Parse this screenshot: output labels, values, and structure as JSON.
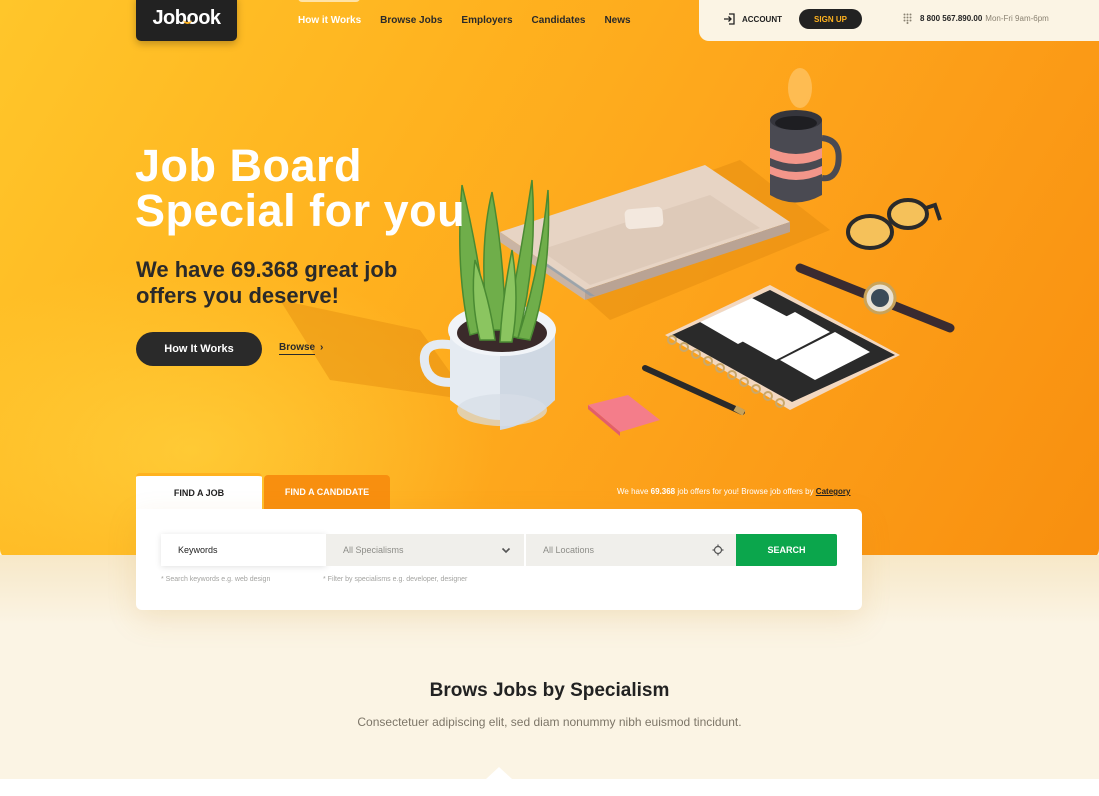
{
  "brand": {
    "logo": "Jobook"
  },
  "nav": {
    "items": [
      "How it Works",
      "Browse Jobs",
      "Employers",
      "Candidates",
      "News"
    ],
    "active_index": 0
  },
  "header": {
    "account_label": "ACCOUNT",
    "signup_label": "SIGN UP",
    "phone_number": "8 800 567.890.00",
    "phone_hours": "Mon-Fri 9am-6pm"
  },
  "hero": {
    "title_line1": "Job Board",
    "title_line2": "Special for you",
    "subtitle_line1": "We have 69.368 great job",
    "subtitle_line2": "offers you deserve!",
    "primary_button": "How It Works",
    "browse_link": "Browse",
    "browse_chevron": "›"
  },
  "search": {
    "tabs": [
      "FIND A JOB",
      "FIND A CANDIDATE"
    ],
    "active_tab": 0,
    "offers_prefix": "We have ",
    "offers_count": "69.368",
    "offers_suffix": " job offers for you! Browse job offers by ",
    "offers_link": "Category",
    "keywords_value": "Keywords",
    "specialisms_value": "All Specialisms",
    "locations_value": "All Locations",
    "search_button": "SEARCH",
    "hint_keywords": "* Search keywords e.g. web design",
    "hint_specialisms": "* Filter by specialisms e.g. developer, designer"
  },
  "section": {
    "title": "Brows Jobs by Specialism",
    "subtitle": "Consectetuer adipiscing elit, sed diam nonummy nibh euismod tincidunt."
  },
  "colors": {
    "accent_yellow": "#ffb21f",
    "accent_orange": "#f88f0f",
    "dark": "#222222",
    "search_green": "#0ba64c",
    "page_cream": "#fbf4e4"
  },
  "icons": [
    "login-icon",
    "phone-keypad-icon",
    "chevron-down-icon",
    "crosshair-icon",
    "chevron-right-icon"
  ]
}
